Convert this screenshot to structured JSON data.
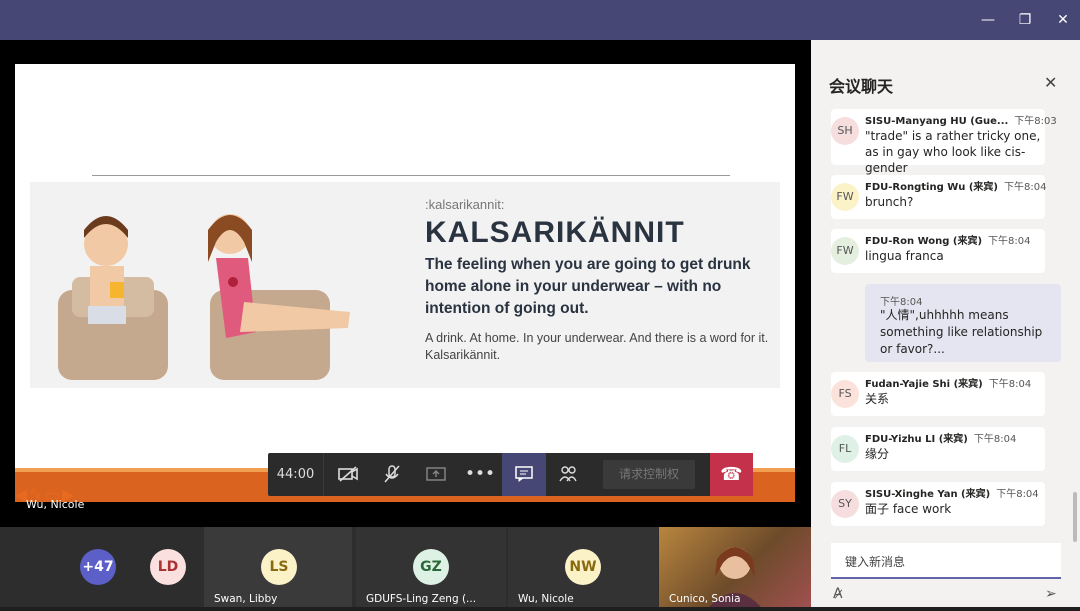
{
  "window": {
    "minimize": "—",
    "restore": "❐",
    "close": "✕"
  },
  "slide": {
    "tag": ":kalsarikannit:",
    "word": "KALSARIKÄNNIT",
    "definition": "The feeling when you are going to get drunk home alone in your underwear – with no intention of going out.",
    "subtext": "A drink. At home. In your underwear. And there is a word for it. Kalsarikännit.",
    "presenter": "Wu, Nicole"
  },
  "toolbar": {
    "timer": "44:00",
    "camera_icon": "camera-off-icon",
    "mic_icon": "mic-off-icon",
    "share_icon": "share-icon",
    "more": "•••",
    "request_control": "请求控制权",
    "hangup": "☎"
  },
  "participants": [
    {
      "initials": "+47",
      "name": ""
    },
    {
      "initials": "LD",
      "name": ""
    },
    {
      "initials": "LS",
      "name": "Swan, Libby"
    },
    {
      "initials": "GZ",
      "name": "GDUFS-Ling Zeng (..."
    },
    {
      "initials": "NW",
      "name": "Wu, Nicole"
    },
    {
      "initials": "",
      "name": "Cunico, Sonia"
    }
  ],
  "chat": {
    "title": "会议聊天",
    "messages": [
      {
        "initials": "SH",
        "sender": "SISU-Manyang HU (Gue...",
        "time": "下午8:03",
        "text": "\"trade\" is a rather tricky one, as in gay who look like cis-gender"
      },
      {
        "initials": "FW",
        "sender": "FDU-Rongting Wu (来宾)",
        "time": "下午8:04",
        "text": "brunch?"
      },
      {
        "initials": "FW",
        "sender": "FDU-Ron Wong (来宾)",
        "time": "下午8:04",
        "text": "lingua franca"
      },
      {
        "initials": "FS",
        "sender": "Fudan-Yajie Shi (来宾)",
        "time": "下午8:04",
        "text": "关系"
      },
      {
        "initials": "FL",
        "sender": "FDU-Yizhu LI (来宾)",
        "time": "下午8:04",
        "text": "缘分"
      },
      {
        "initials": "SY",
        "sender": "SISU-Xinghe Yan (来宾)",
        "time": "下午8:04",
        "text": "面子 face work"
      }
    ],
    "own_message": {
      "time": "下午8:04",
      "text": "\"人情\",uhhhhh means something like relationship or favor?..."
    },
    "input_placeholder": "键入新消息"
  },
  "colors": {
    "accent": "#6264a7",
    "titlebar": "#464775",
    "hangup": "#c4314b",
    "slide_bar": "#d9631f"
  }
}
